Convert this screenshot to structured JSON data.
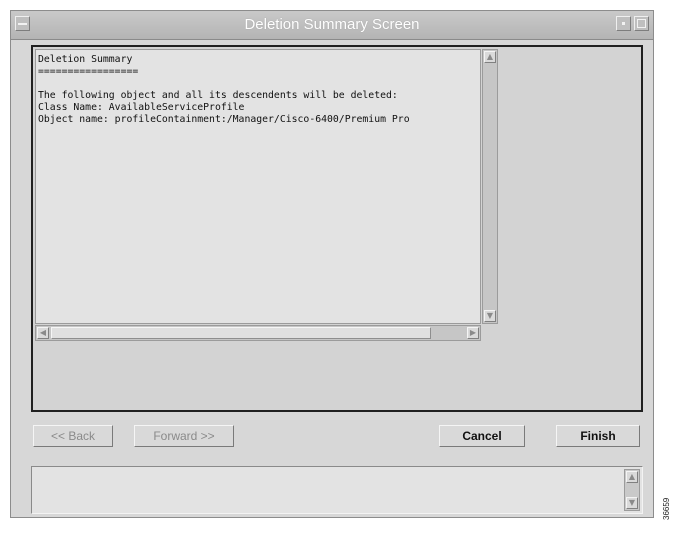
{
  "window": {
    "title": "Deletion Summary Screen"
  },
  "summary": {
    "heading": "Deletion Summary",
    "underline": "=================",
    "message": "The following object and all its descendents will be deleted:",
    "class_line": "Class Name: AvailableServiceProfile",
    "object_line": "Object name: profileContainment:/Manager/Cisco-6400/Premium Pro"
  },
  "buttons": {
    "back": "<< Back",
    "forward": "Forward >>",
    "cancel": "Cancel",
    "finish": "Finish"
  },
  "figure_number": "36659",
  "icons": {
    "window_menu": "window-menu-icon",
    "minimize": "minimize-icon",
    "maximize": "maximize-icon",
    "arrow_up": "arrow-up-icon",
    "arrow_down": "arrow-down-icon",
    "arrow_left": "arrow-left-icon",
    "arrow_right": "arrow-right-icon"
  }
}
